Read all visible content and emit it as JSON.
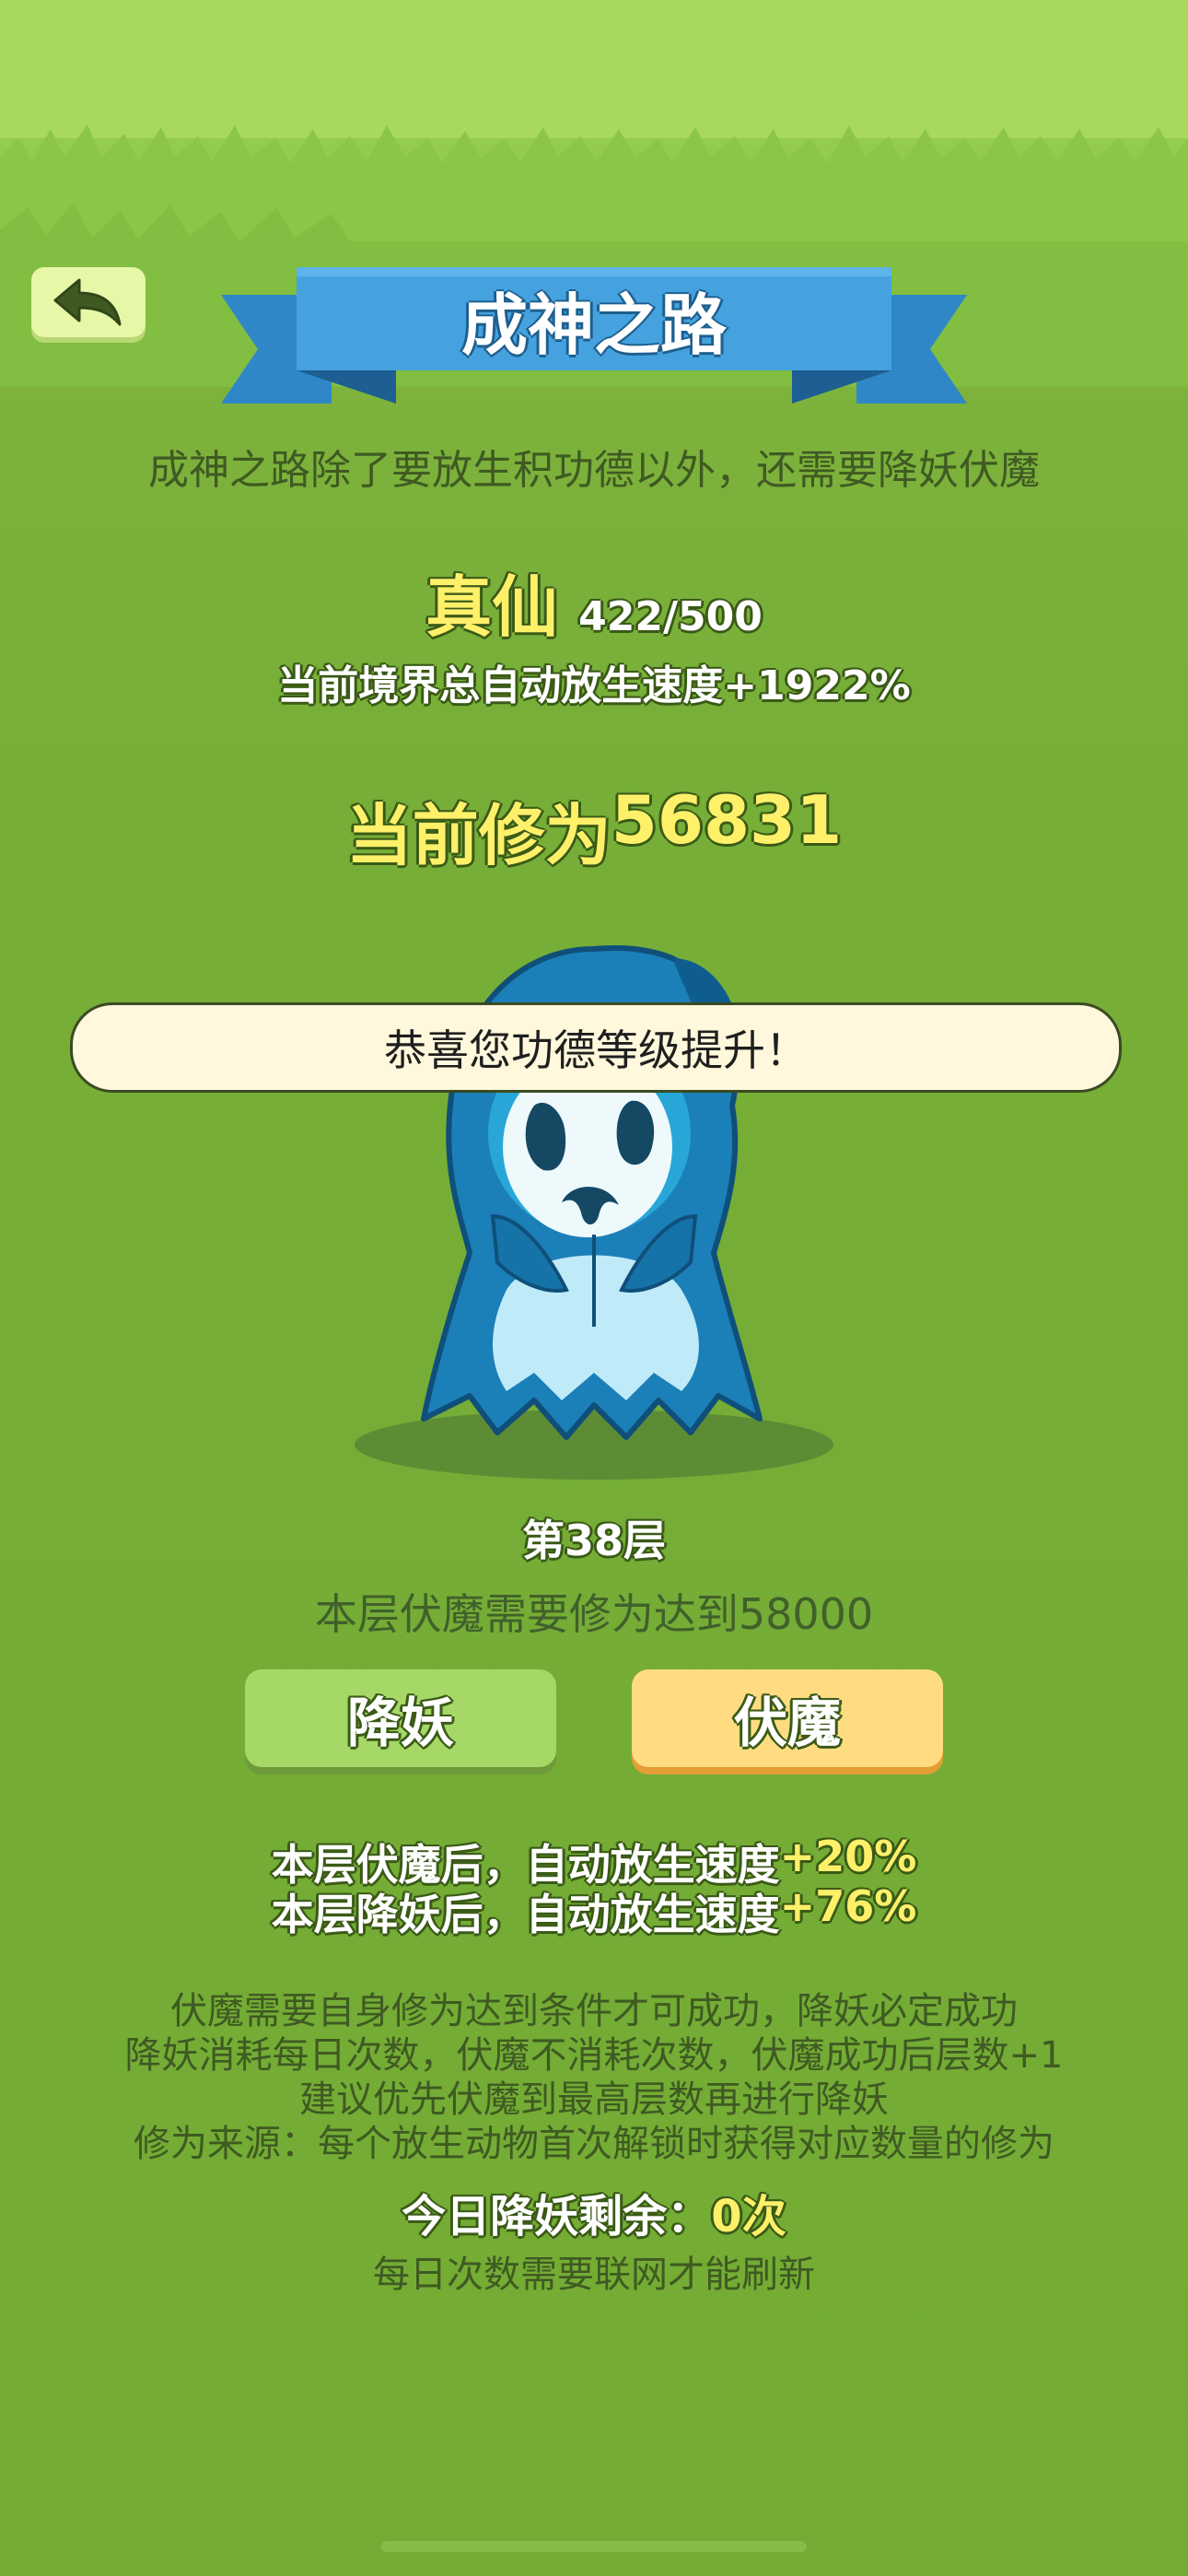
{
  "header": {
    "title": "成神之路",
    "back_icon": "back-arrow-icon"
  },
  "subtitle": "成神之路除了要放生积功德以外，还需要降妖伏魔",
  "rank": {
    "name": "真仙",
    "progress": "422/500"
  },
  "speed_total": "当前境界总自动放生速度+1922%",
  "cultivation": {
    "label": "当前修为",
    "value": "56831"
  },
  "toast": "恭喜您功德等级提升！",
  "floor": {
    "label": "第38层",
    "requirement": "本层伏魔需要修为达到58000"
  },
  "buttons": {
    "subdue_demon": "降妖",
    "subdue_devil": "伏魔"
  },
  "bonuses": {
    "devil_label": "本层伏魔后，自动放生速度",
    "devil_value": "+20%",
    "demon_label": "本层降妖后，自动放生速度",
    "demon_value": "+76%"
  },
  "notes": [
    "伏魔需要自身修为达到条件才可成功，降妖必定成功",
    "降妖消耗每日次数，伏魔不消耗次数，伏魔成功后层数+1",
    "建议优先伏魔到最高层数再进行降妖",
    "修为来源：每个放生动物首次解锁时获得对应数量的修为"
  ],
  "remaining": {
    "label": "今日降妖剩余：",
    "value": "0次"
  },
  "refresh_note": "每日次数需要联网才能刷新",
  "colors": {
    "banner_blue": "#3f9fdc",
    "highlight_yellow": "#fff06a",
    "button_green": "#a6d868",
    "button_yellow": "#ffdc82",
    "ghost_blue": "#1b7fb8"
  }
}
